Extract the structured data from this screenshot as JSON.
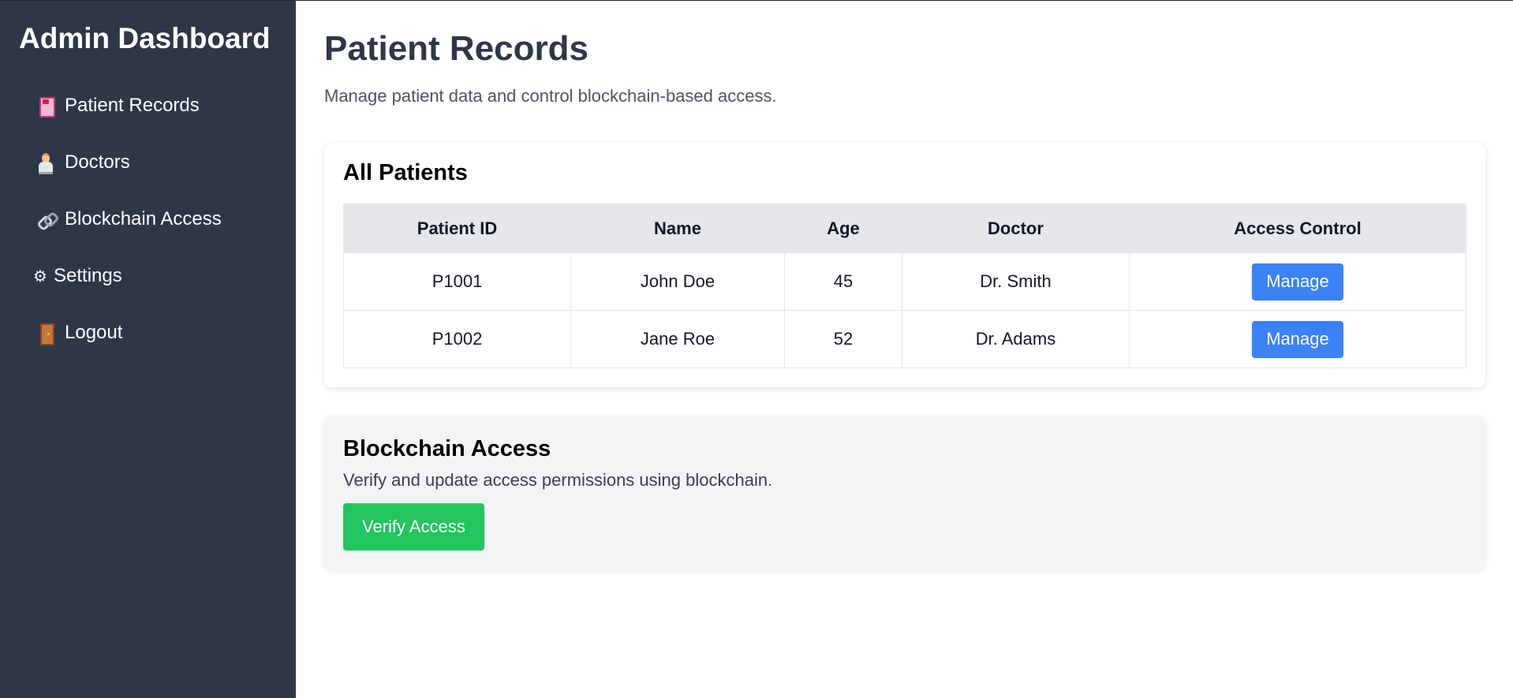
{
  "sidebar": {
    "title": "Admin Dashboard",
    "items": [
      {
        "icon": "medical-records-icon",
        "label": "Patient Records"
      },
      {
        "icon": "doctor-icon",
        "label": "Doctors"
      },
      {
        "icon": "link-icon",
        "label": "Blockchain Access"
      },
      {
        "icon": "gear-icon",
        "label": "Settings",
        "glyph": "⚙"
      },
      {
        "icon": "door-icon",
        "label": "Logout"
      }
    ]
  },
  "header": {
    "title": "Patient Records",
    "subtitle": "Manage patient data and control blockchain-based access."
  },
  "patients_card": {
    "title": "All Patients",
    "columns": [
      "Patient ID",
      "Name",
      "Age",
      "Doctor",
      "Access Control"
    ],
    "rows": [
      {
        "id": "P1001",
        "name": "John Doe",
        "age": "45",
        "doctor": "Dr. Smith",
        "action": "Manage"
      },
      {
        "id": "P1002",
        "name": "Jane Roe",
        "age": "52",
        "doctor": "Dr. Adams",
        "action": "Manage"
      }
    ]
  },
  "blockchain_card": {
    "title": "Blockchain Access",
    "text": "Verify and update access permissions using blockchain.",
    "button": "Verify Access"
  },
  "colors": {
    "sidebar_bg": "#2d3748",
    "primary_button": "#3b82f6",
    "success_button": "#22c55e"
  }
}
